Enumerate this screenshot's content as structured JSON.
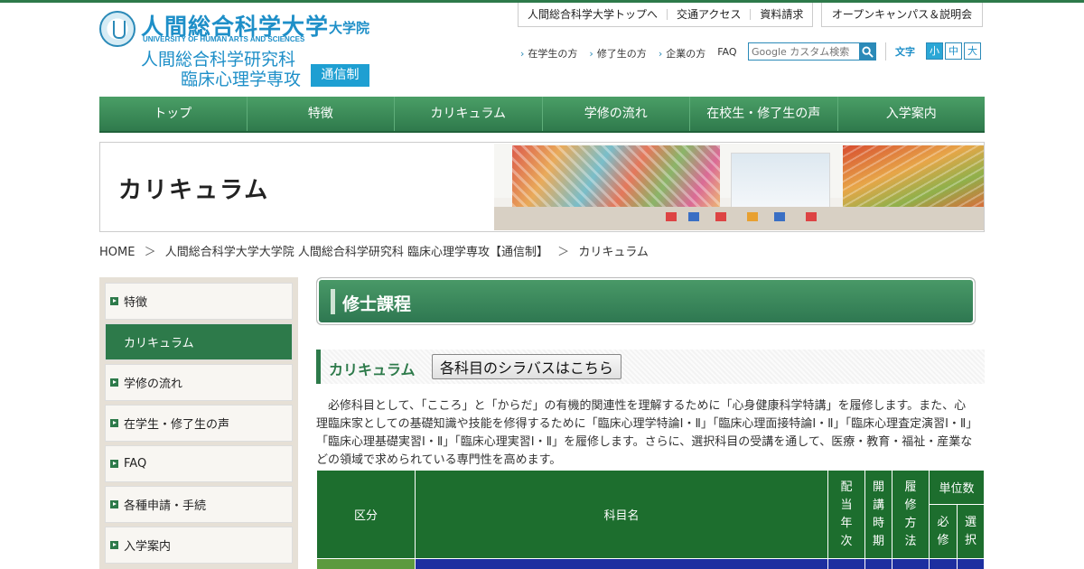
{
  "header": {
    "logo": {
      "university": "人間総合科学大学",
      "graduate": "大学院",
      "english": "UNIVERSITY OF HUMAN ARTS AND SCIENCES",
      "dept_line1": "人間総合科学研究科",
      "dept_line2": "臨床心理学専攻",
      "badge": "通信制"
    },
    "top_links": [
      "人間総合科学大学トップへ",
      "交通アクセス",
      "資料請求"
    ],
    "open_campus": "オープンキャンパス＆説明会",
    "sub_links": [
      "在学生の方",
      "修了生の方",
      "企業の方",
      "FAQ"
    ],
    "search_placeholder": "Google カスタム検索",
    "font_size_label": "文字",
    "font_sizes": [
      "小",
      "中",
      "大"
    ]
  },
  "nav": [
    "トップ",
    "特徴",
    "カリキュラム",
    "学修の流れ",
    "在校生・修了生の声",
    "入学案内"
  ],
  "banner": {
    "title": "カリキュラム"
  },
  "breadcrumb": [
    "HOME",
    "＞",
    "人間総合科学大学大学院 人間総合科学研究科 臨床心理学専攻【通信制】",
    "＞",
    "カリキュラム"
  ],
  "sidebar": [
    "特徴",
    "カリキュラム",
    "学修の流れ",
    "在学生・修了生の声",
    "FAQ",
    "各種申請・手続",
    "入学案内"
  ],
  "main": {
    "heading": "修士課程",
    "section_title": "カリキュラム",
    "syllabus_button": "各科目のシラバスはこちら",
    "intro": "必修科目として、「こころ」と「からだ」の有機的関連性を理解するために「心身健康科学特講」を履修します。また、心理臨床家としての基礎知識や技能を修得するために「臨床心理学特論Ⅰ・Ⅱ」「臨床心理面接特論Ⅰ・Ⅱ」「臨床心理査定演習Ⅰ・Ⅱ」「臨床心理基礎実習Ⅰ・Ⅱ」「臨床心理実習Ⅰ・Ⅱ」を履修します。さらに、選択科目の受講を通して、医療・教育・福祉・産業などの領域で求められている専門性を高めます。",
    "table": {
      "col_category": "区分",
      "col_subject": "科目名",
      "col_year": [
        "配",
        "当",
        "年",
        "次"
      ],
      "col_period": [
        "開",
        "講",
        "時",
        "期"
      ],
      "col_method": [
        "履",
        "修",
        "方",
        "法"
      ],
      "col_units": "単位数",
      "col_required": [
        "必",
        "修"
      ],
      "col_elective": [
        "選",
        "択"
      ]
    }
  },
  "colors": {
    "primary_green": "#2d7a4a",
    "brand_blue": "#1e8fc8",
    "table_header": "#1d6e2e",
    "table_row_blue": "#1d2fa0"
  }
}
